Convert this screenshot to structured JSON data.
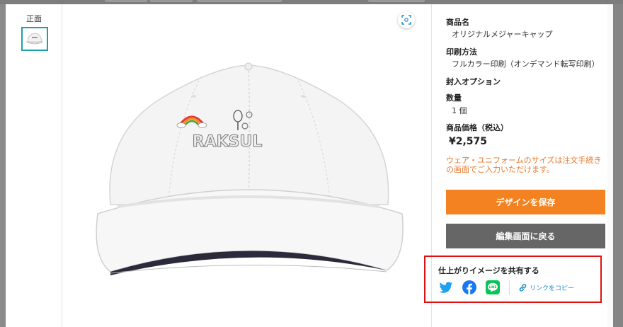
{
  "thumbnails": {
    "items": [
      {
        "label": "正面"
      }
    ]
  },
  "product": {
    "name_label": "商品名",
    "name_value": "オリジナルメジャーキャップ",
    "print_label": "印刷方法",
    "print_value": "フルカラー印刷（オンデマンド転写印刷）",
    "option_label": "封入オプション",
    "quantity_label": "数量",
    "quantity_value": "1 個",
    "price_label": "商品価格（税込）",
    "price_value": "¥2,575",
    "notice": "ウェア・ユニフォームのサイズは注文手続きの画面でご入力いただけます。"
  },
  "actions": {
    "save_label": "デザインを保存",
    "back_label": "編集画面に戻る"
  },
  "share": {
    "title": "仕上がりイメージを共有する",
    "copy_label": "リンクをコピー"
  },
  "preview": {
    "logo_text": "RAKSUL"
  },
  "icons": [
    "expand-icon",
    "twitter-icon",
    "facebook-icon",
    "line-icon",
    "link-icon"
  ],
  "colors": {
    "accent": "#f58220",
    "secondary": "#666666",
    "highlight": "#e01010",
    "link": "#1a8fc9"
  }
}
